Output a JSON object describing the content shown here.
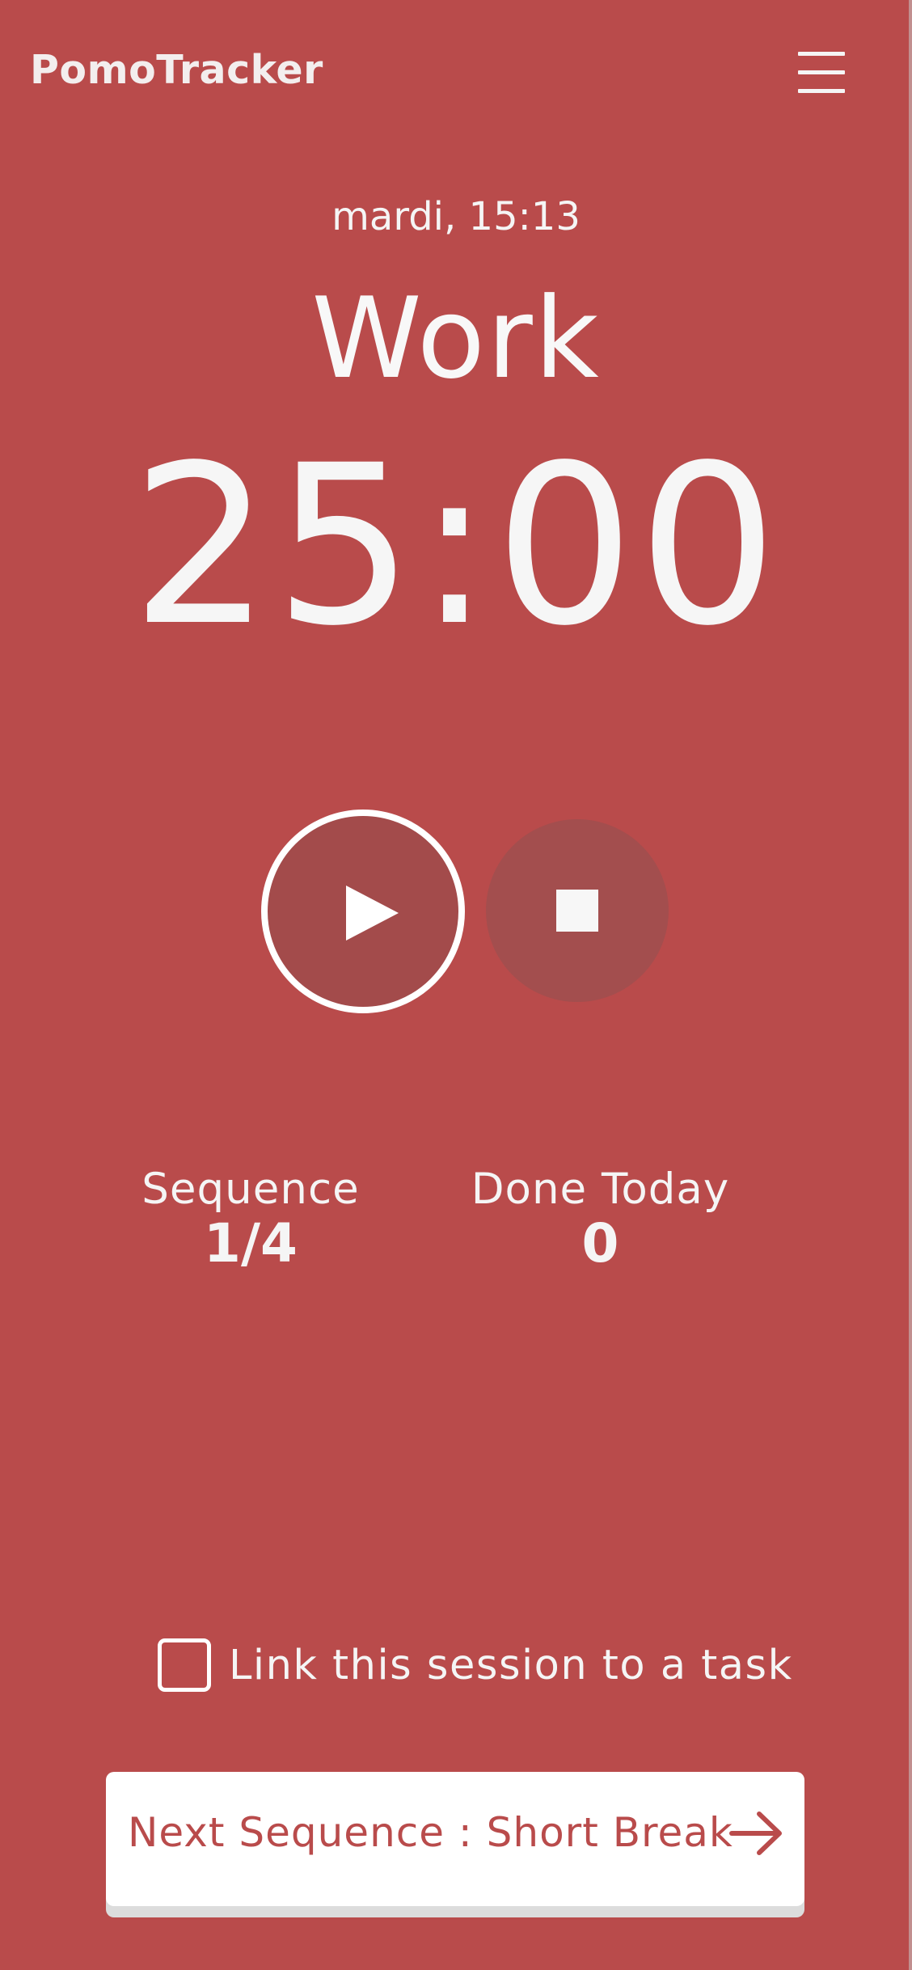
{
  "header": {
    "app_title": "PomoTracker",
    "menu_icon": "hamburger-menu-icon"
  },
  "session": {
    "datetime": "mardi, 15:13",
    "mode": "Work",
    "timer": "25:00"
  },
  "controls": {
    "play_icon": "play-icon",
    "stop_icon": "stop-icon"
  },
  "stats": {
    "sequence_label": "Sequence",
    "sequence_value": "1/4",
    "done_today_label": "Done Today",
    "done_today_value": "0"
  },
  "task_link": {
    "label": "Link this session to a task",
    "checked": false
  },
  "next": {
    "label": "Next Sequence : Short Break",
    "icon": "arrow-right-icon"
  },
  "colors": {
    "background": "#b94b4b",
    "button_dark": "#a34b4b",
    "text": "#f5f5f5",
    "card": "#ffffff"
  }
}
